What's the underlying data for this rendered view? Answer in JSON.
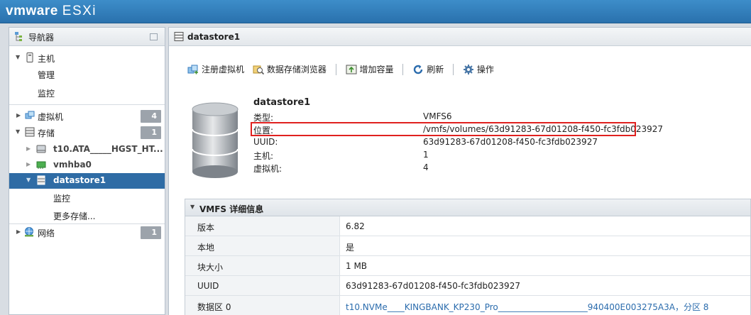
{
  "header": {
    "brand": "vmware",
    "product": "ESXi"
  },
  "navigator": {
    "title": "导航器",
    "host": {
      "label": "主机",
      "children": [
        "管理",
        "监控"
      ]
    },
    "vms": {
      "label": "虚拟机",
      "count": "4"
    },
    "storage": {
      "label": "存储",
      "count": "1",
      "children": [
        {
          "label": "t10.ATA_____HGST_HT..."
        },
        {
          "label": "vmhba0"
        },
        {
          "label": "datastore1"
        }
      ],
      "datastore_children": [
        "监控",
        "更多存储..."
      ]
    },
    "network": {
      "label": "网络",
      "count": "1"
    }
  },
  "main": {
    "title": "datastore1",
    "toolbar": {
      "register_vm": "注册虚拟机",
      "datastore_browser": "数据存储浏览器",
      "increase_capacity": "增加容量",
      "refresh": "刷新",
      "actions": "操作"
    },
    "summary": {
      "name": "datastore1",
      "fields": [
        {
          "key": "类型:",
          "value": "VMFS6"
        },
        {
          "key": "位置:",
          "value": "/vmfs/volumes/63d91283-67d01208-f450-fc3fdb023927"
        },
        {
          "key": "UUID:",
          "value": "63d91283-67d01208-f450-fc3fdb023927"
        },
        {
          "key": "主机:",
          "value": "1"
        },
        {
          "key": "虚拟机:",
          "value": "4"
        }
      ]
    },
    "vmfs_details": {
      "title": "VMFS 详细信息",
      "rows": [
        {
          "key": "版本",
          "value": "6.82"
        },
        {
          "key": "本地",
          "value": "是"
        },
        {
          "key": "块大小",
          "value": "1 MB"
        },
        {
          "key": "UUID",
          "value": "63d91283-67d01208-f450-fc3fdb023927"
        },
        {
          "key": "数据区 0",
          "value": "t10.NVMe____KINGBANK_KP230_Pro_____________________940400E003275A3A，分区 8"
        }
      ]
    }
  },
  "colors": {
    "header": "#2f7cbb",
    "selected": "#2f6ca5",
    "highlight_box": "#e0211f",
    "link": "#2b6cad"
  }
}
